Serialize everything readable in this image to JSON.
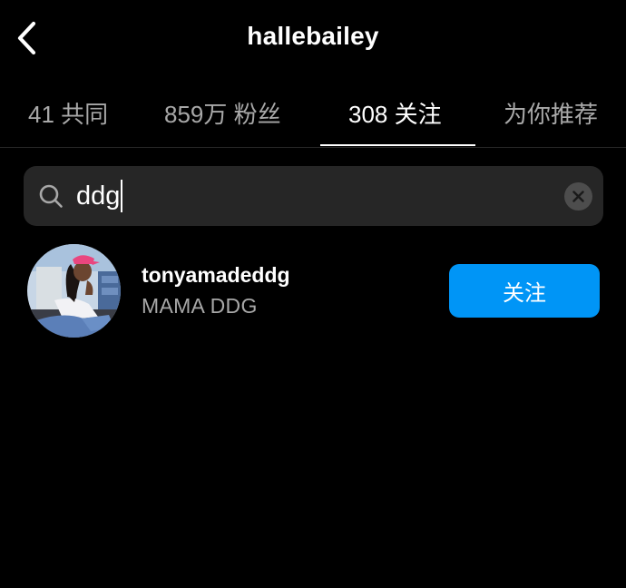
{
  "header": {
    "title": "hallebailey",
    "back_icon": "chevron-left-icon"
  },
  "tabs": [
    {
      "label": "41 共同",
      "active": false
    },
    {
      "label": "859万 粉丝",
      "active": false
    },
    {
      "label": "308 关注",
      "active": true
    },
    {
      "label": "为你推荐",
      "active": false
    }
  ],
  "search": {
    "value": "ddg",
    "icon": "search-icon",
    "clear_icon": "clear-icon"
  },
  "results": [
    {
      "username": "tonyamadeddg",
      "full_name": "MAMA DDG",
      "button_label": "关注"
    }
  ],
  "colors": {
    "background": "#000000",
    "accent": "#0095f6",
    "secondary_text": "#a8a8a8",
    "search_bg": "#262626"
  }
}
